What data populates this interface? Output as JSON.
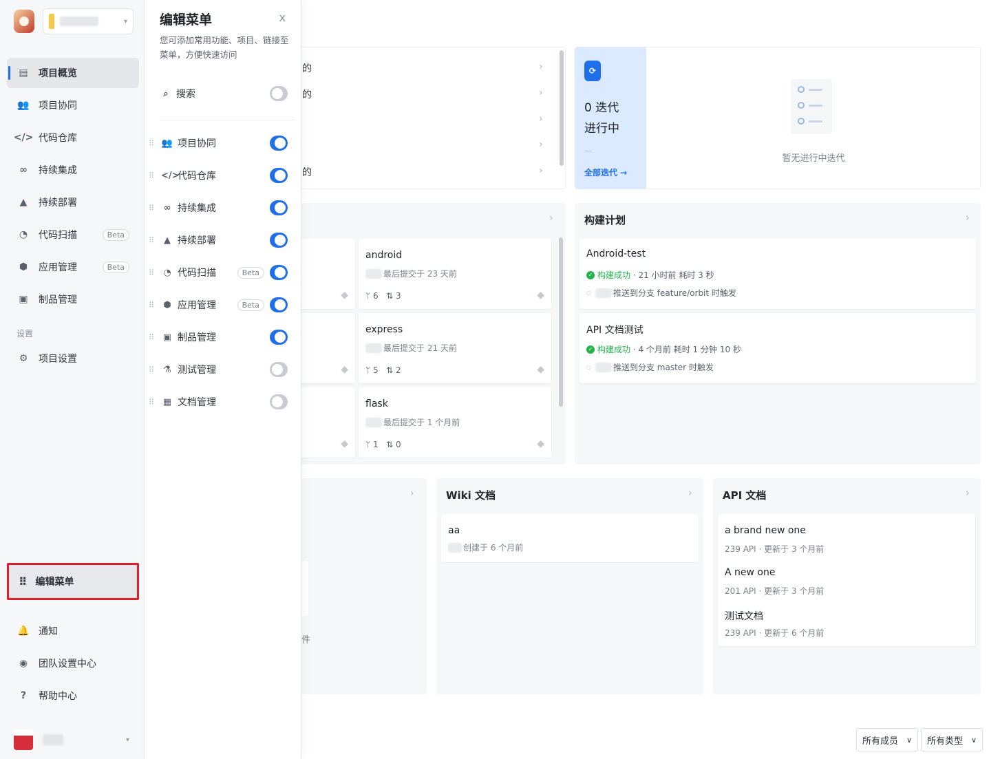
{
  "sidebar": {
    "items": [
      {
        "label": "项目概览",
        "icon": "overview-icon"
      },
      {
        "label": "项目协同",
        "icon": "people-icon"
      },
      {
        "label": "代码仓库",
        "icon": "code-icon"
      },
      {
        "label": "持续集成",
        "icon": "infinity-icon"
      },
      {
        "label": "持续部署",
        "icon": "rocket-icon"
      },
      {
        "label": "代码扫描",
        "icon": "pie-icon",
        "badge": "Beta"
      },
      {
        "label": "应用管理",
        "icon": "cube-icon",
        "badge": "Beta"
      },
      {
        "label": "制品管理",
        "icon": "box-icon"
      }
    ],
    "settings_label": "设置",
    "project_settings": "项目设置",
    "edit_menu": "编辑菜单",
    "notify": "通知",
    "team_settings": "团队设置中心",
    "help": "帮助中心"
  },
  "panel": {
    "title": "编辑菜单",
    "close": "x",
    "description": "您可添加常用功能、项目、链接至菜单，方便快速访问",
    "search": {
      "label": "搜索",
      "on": false
    },
    "rows": [
      {
        "label": "项目协同",
        "on": true
      },
      {
        "label": "代码仓库",
        "on": true
      },
      {
        "label": "持续集成",
        "on": true
      },
      {
        "label": "持续部署",
        "on": true
      },
      {
        "label": "代码扫描",
        "badge": "Beta",
        "on": true
      },
      {
        "label": "应用管理",
        "badge": "Beta",
        "on": true
      },
      {
        "label": "制品管理",
        "on": true
      },
      {
        "label": "测试管理",
        "on": false
      },
      {
        "label": "文档管理",
        "on": false
      }
    ]
  },
  "main": {
    "frag_de": "的",
    "frag_jian": "件",
    "iteration": {
      "count": "0 迭代",
      "status": "进行中",
      "dash": "—",
      "all_link": "全部迭代 →",
      "empty": "暂无进行中迭代"
    },
    "repos": [
      {
        "name": "android",
        "updated": "最后提交于 23 天前",
        "branches": "6",
        "prs": "3"
      },
      {
        "name": "express",
        "updated": "最后提交于 21 天前",
        "branches": "5",
        "prs": "2"
      },
      {
        "name": "flask",
        "updated": "最后提交于 1 个月前",
        "branches": "1",
        "prs": "0"
      }
    ],
    "builds": {
      "title": "构建计划",
      "items": [
        {
          "name": "Android-test",
          "status": "构建成功",
          "meta": "· 21 小时前  耗时 3 秒",
          "trigger": "推送到分支 feature/orbit 时触发"
        },
        {
          "name": "API 文档测试",
          "status": "构建成功",
          "meta": "· 4 个月前  耗时 1 分钟 10 秒",
          "trigger": "推送到分支 master 时触发"
        }
      ]
    },
    "wiki": {
      "title": "Wiki 文档",
      "items": [
        {
          "name": "aa",
          "sub": "创建于 6 个月前"
        }
      ]
    },
    "api": {
      "title": "API 文档",
      "items": [
        {
          "name": "a brand new one",
          "sub": "239 API · 更新于 3 个月前"
        },
        {
          "name": "A new one",
          "sub": "201 API · 更新于 3 个月前"
        },
        {
          "name": "测试文档",
          "sub": "239 API · 更新于 6 个月前"
        }
      ]
    },
    "filters": {
      "members": "所有成员",
      "types": "所有类型"
    }
  },
  "colors": {
    "accent": "#1f6feb",
    "highlight_border": "#d9202b",
    "success": "#22b34a"
  }
}
